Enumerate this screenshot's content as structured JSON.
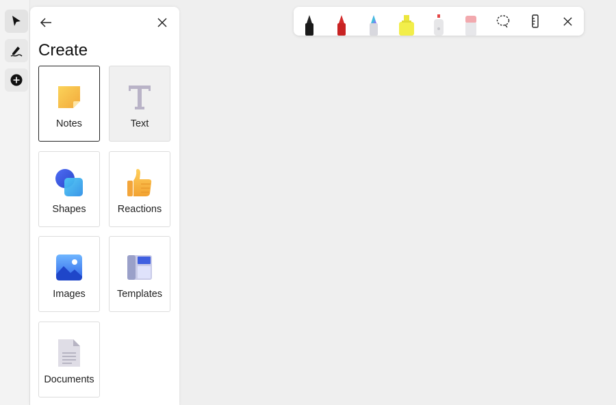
{
  "panel": {
    "title": "Create",
    "tiles": [
      {
        "label": "Notes",
        "icon": "sticky-note-icon"
      },
      {
        "label": "Text",
        "icon": "text-icon"
      },
      {
        "label": "Shapes",
        "icon": "shapes-icon"
      },
      {
        "label": "Reactions",
        "icon": "thumbs-up-icon"
      },
      {
        "label": "Images",
        "icon": "image-icon"
      },
      {
        "label": "Templates",
        "icon": "template-icon"
      },
      {
        "label": "Documents",
        "icon": "document-icon"
      }
    ]
  },
  "rail": {
    "items": [
      "select-pointer-icon",
      "pen-icon",
      "add-icon"
    ]
  },
  "toolbar": {
    "tools": [
      "black-pen-icon",
      "red-pen-icon",
      "galaxy-pen-icon",
      "highlighter-icon",
      "laser-pointer-icon",
      "eraser-icon",
      "lasso-icon",
      "ruler-icon",
      "close-icon"
    ]
  },
  "colors": {
    "canvas": "#efefef",
    "note_yellow": "#f7c948",
    "shape_blue": "#3b6fe0",
    "highlighter": "#f2ee4a",
    "pen_red": "#d32a2a"
  }
}
